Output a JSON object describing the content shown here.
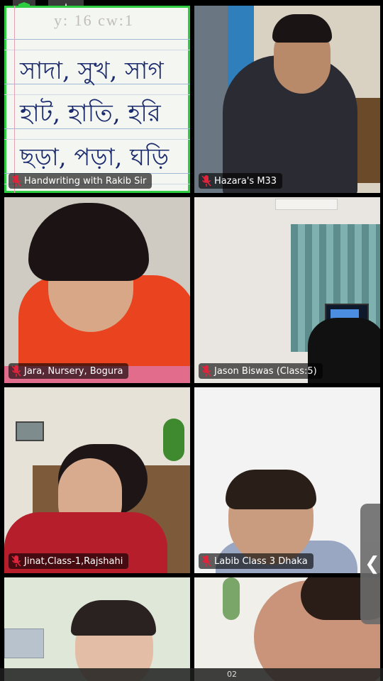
{
  "tiles": [
    {
      "name": "Handwriting with Rakib Sir",
      "active": true
    },
    {
      "name": "Hazara's M33"
    },
    {
      "name": "Jara, Nursery, Bogura"
    },
    {
      "name": "Jason Biswas (Class:5)"
    },
    {
      "name": "Jinat,Class-1,Rajshahi"
    },
    {
      "name": "Labib Class 3 Dhaka"
    },
    {
      "name": ""
    },
    {
      "name": ""
    }
  ],
  "handwriting": {
    "header": "y: 16   cw:1",
    "line1": "সাদা, সুখ, সাগ",
    "line2": "হাট, হাতি, হরি",
    "line3": "ছড়া, পড়া, ঘড়ি"
  },
  "bottom_bar": {
    "pager": "02"
  },
  "side_handle": {
    "chevron": "❮"
  },
  "colors": {
    "active_border": "#2ecc40",
    "mic_muted": "#e0243b",
    "shield": "#2ecc40"
  },
  "icons": [
    "shield-check-icon",
    "sparkle-icon",
    "mic-muted-icon",
    "chevron-left-icon"
  ]
}
